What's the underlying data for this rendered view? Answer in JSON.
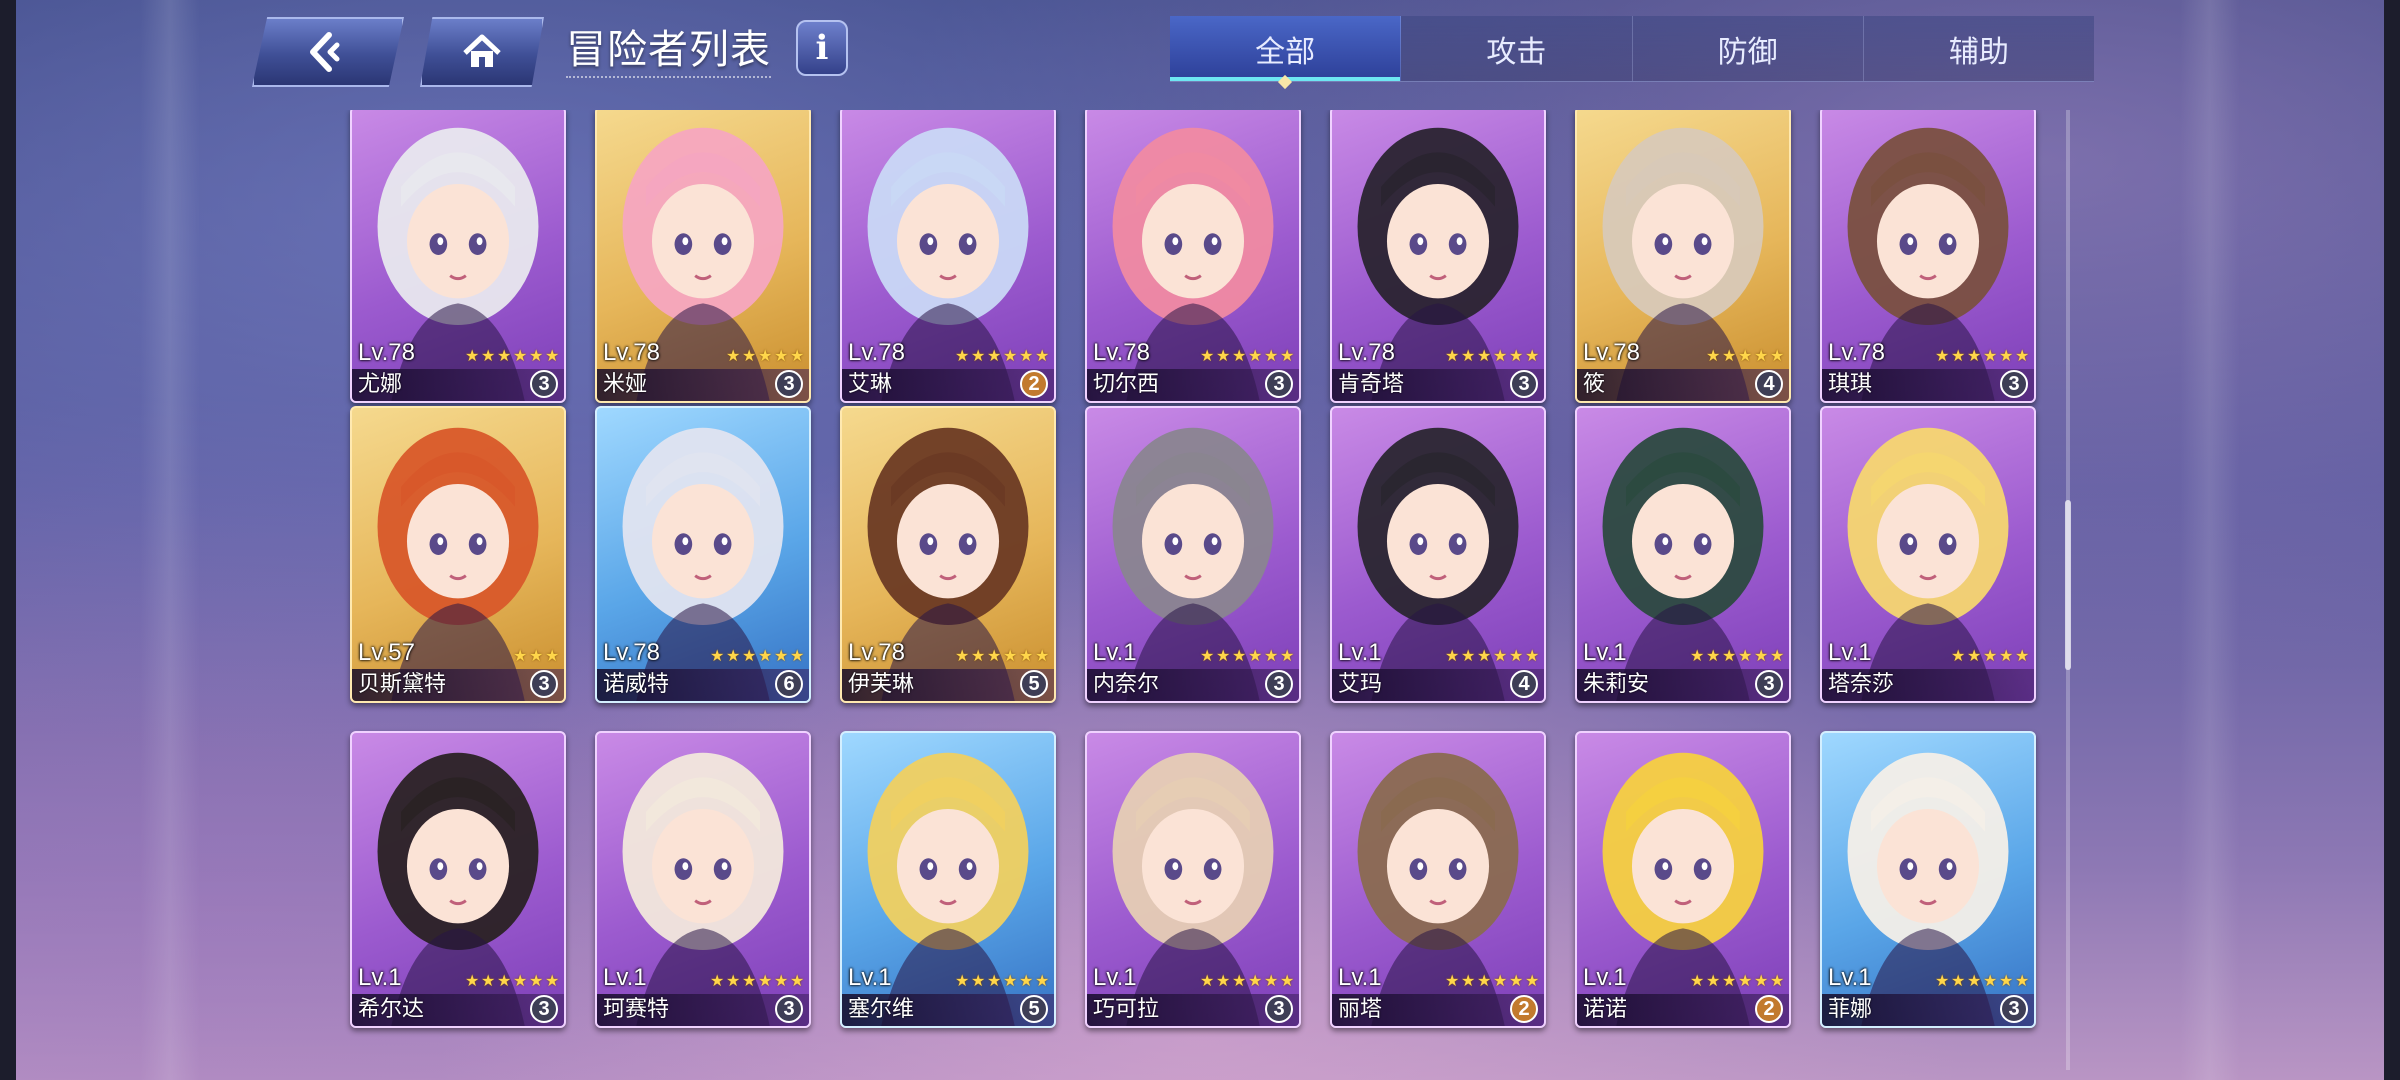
{
  "header": {
    "title": "冒险者列表",
    "info_label": "i",
    "back_icon": "back-arrow-icon",
    "home_icon": "home-icon"
  },
  "tabs": [
    {
      "label": "全部",
      "active": true
    },
    {
      "label": "攻击",
      "active": false
    },
    {
      "label": "防御",
      "active": false
    },
    {
      "label": "辅助",
      "active": false
    }
  ],
  "colors": {
    "accent": "#4a67c7",
    "tab_underline": "#6ee6f2",
    "star": "#ffd64a"
  },
  "cards": [
    {
      "name": "尤娜",
      "level": "Lv.78",
      "stars": 6,
      "count": "3",
      "frame": "purple"
    },
    {
      "name": "米娅",
      "level": "Lv.78",
      "stars": 5,
      "count": "3",
      "frame": "gold"
    },
    {
      "name": "艾琳",
      "level": "Lv.78",
      "stars": 6,
      "count": "2",
      "frame": "purple"
    },
    {
      "name": "切尔西",
      "level": "Lv.78",
      "stars": 6,
      "count": "3",
      "frame": "purple"
    },
    {
      "name": "肯奇塔",
      "level": "Lv.78",
      "stars": 6,
      "count": "3",
      "frame": "purple"
    },
    {
      "name": "筱",
      "level": "Lv.78",
      "stars": 5,
      "count": "4",
      "frame": "gold"
    },
    {
      "name": "琪琪",
      "level": "Lv.78",
      "stars": 6,
      "count": "3",
      "frame": "purple"
    },
    {
      "name": "贝斯黛特",
      "level": "Lv.57",
      "stars": 3,
      "count": "3",
      "frame": "gold"
    },
    {
      "name": "诺威特",
      "level": "Lv.78",
      "stars": 6,
      "count": "6",
      "frame": "blue"
    },
    {
      "name": "伊芙琳",
      "level": "Lv.78",
      "stars": 6,
      "count": "5",
      "frame": "gold"
    },
    {
      "name": "内奈尔",
      "level": "Lv.1",
      "stars": 6,
      "count": "3",
      "frame": "purple"
    },
    {
      "name": "艾玛",
      "level": "Lv.1",
      "stars": 6,
      "count": "4",
      "frame": "purple"
    },
    {
      "name": "朱莉安",
      "level": "Lv.1",
      "stars": 6,
      "count": "3",
      "frame": "purple"
    },
    {
      "name": "塔奈莎",
      "level": "Lv.1",
      "stars": 5,
      "count": "",
      "frame": "purple"
    },
    {
      "name": "希尔达",
      "level": "Lv.1",
      "stars": 6,
      "count": "3",
      "frame": "purple"
    },
    {
      "name": "珂赛特",
      "level": "Lv.1",
      "stars": 6,
      "count": "3",
      "frame": "purple"
    },
    {
      "name": "塞尔维",
      "level": "Lv.1",
      "stars": 6,
      "count": "5",
      "frame": "blue"
    },
    {
      "name": "巧可拉",
      "level": "Lv.1",
      "stars": 6,
      "count": "3",
      "frame": "purple"
    },
    {
      "name": "丽塔",
      "level": "Lv.1",
      "stars": 6,
      "count": "2",
      "frame": "purple"
    },
    {
      "name": "诺诺",
      "level": "Lv.1",
      "stars": 6,
      "count": "2",
      "frame": "purple"
    },
    {
      "name": "菲娜",
      "level": "Lv.1",
      "stars": 6,
      "count": "3",
      "frame": "blue"
    }
  ]
}
